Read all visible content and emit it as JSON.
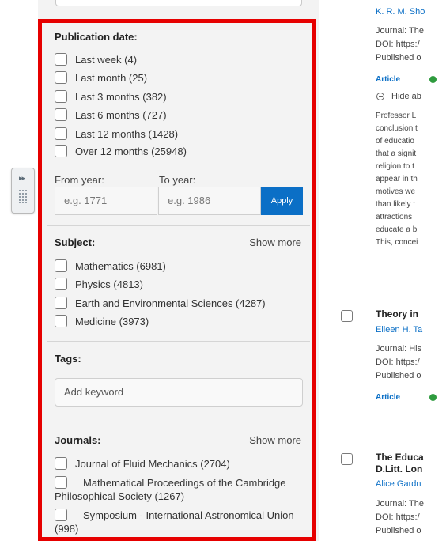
{
  "filters": {
    "publication_date": {
      "title": "Publication date:",
      "options": [
        "Last week (4)",
        "Last month (25)",
        "Last 3 months (382)",
        "Last 6 months (727)",
        "Last 12 months (1428)",
        "Over 12 months (25948)"
      ]
    },
    "year_range": {
      "from_label": "From year:",
      "to_label": "To year:",
      "from_placeholder": "e.g. 1771",
      "to_placeholder": "e.g. 1986",
      "apply_label": "Apply"
    },
    "subject": {
      "title": "Subject:",
      "show_more": "Show more",
      "options": [
        "Mathematics (6981)",
        "Physics (4813)",
        "Earth and Environmental Sciences (4287)",
        "Medicine (3973)"
      ]
    },
    "tags": {
      "title": "Tags:",
      "placeholder": "Add keyword"
    },
    "journals": {
      "title": "Journals:",
      "show_more": "Show more",
      "options": [
        "Journal of Fluid Mechanics (2704)",
        "Mathematical Proceedings of the Cambridge Philosophical Society (1267)",
        "Symposium - International Astronomical Union (998)"
      ]
    }
  },
  "results": {
    "first": {
      "author": "K. R. M. Sho",
      "journal": "Journal: The",
      "doi": "DOI: https:/",
      "published": "Published o",
      "type": "Article",
      "hide_abstract": "Hide ab",
      "abstract_lines": [
        "Professor L",
        "conclusion t",
        "of educatio",
        "that a signit",
        "religion to t",
        "appear in th",
        "motives we",
        "than likely t",
        "attractions",
        "educate a b",
        "This, concei"
      ]
    },
    "second": {
      "title": "Theory in",
      "author": "Eileen H. Ta",
      "journal": "Journal: His",
      "doi": "DOI: https:/",
      "published": "Published o",
      "type": "Article"
    },
    "third": {
      "title_line1": "The Educa",
      "title_line2": "D.Litt. Lon",
      "author": "Alice Gardn",
      "journal": "Journal: The",
      "doi": "DOI: https:/",
      "published": "Published o"
    }
  },
  "colors": {
    "highlight_outline": "#e60000",
    "accent": "#0b6fc6",
    "access_badge": "#2e9b3e"
  }
}
